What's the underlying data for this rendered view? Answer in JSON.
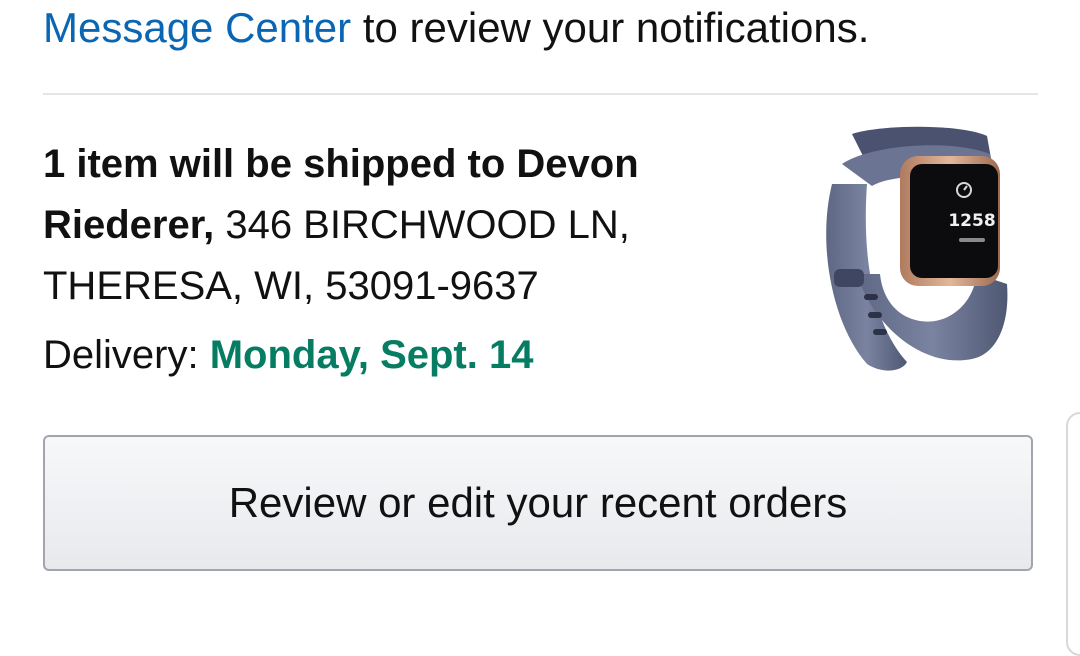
{
  "notification": {
    "link_text": "Message Center",
    "rest_text": " to review your notifications."
  },
  "shipment": {
    "lead_bold": "1 item will be shipped to Devon Riederer,",
    "address": " 346 BIRCHWOOD LN, THERESA, WI, 53091-9637",
    "delivery_label": "Delivery: ",
    "delivery_date": "Monday, Sept. 14"
  },
  "product": {
    "image_icon": "fitness-tracker-watch",
    "screen_time": "1258"
  },
  "actions": {
    "review_orders_label": "Review or edit your recent orders"
  },
  "colors": {
    "link": "#0a66b3",
    "delivery_date": "#067d62",
    "button_border": "#a2a6ac"
  }
}
